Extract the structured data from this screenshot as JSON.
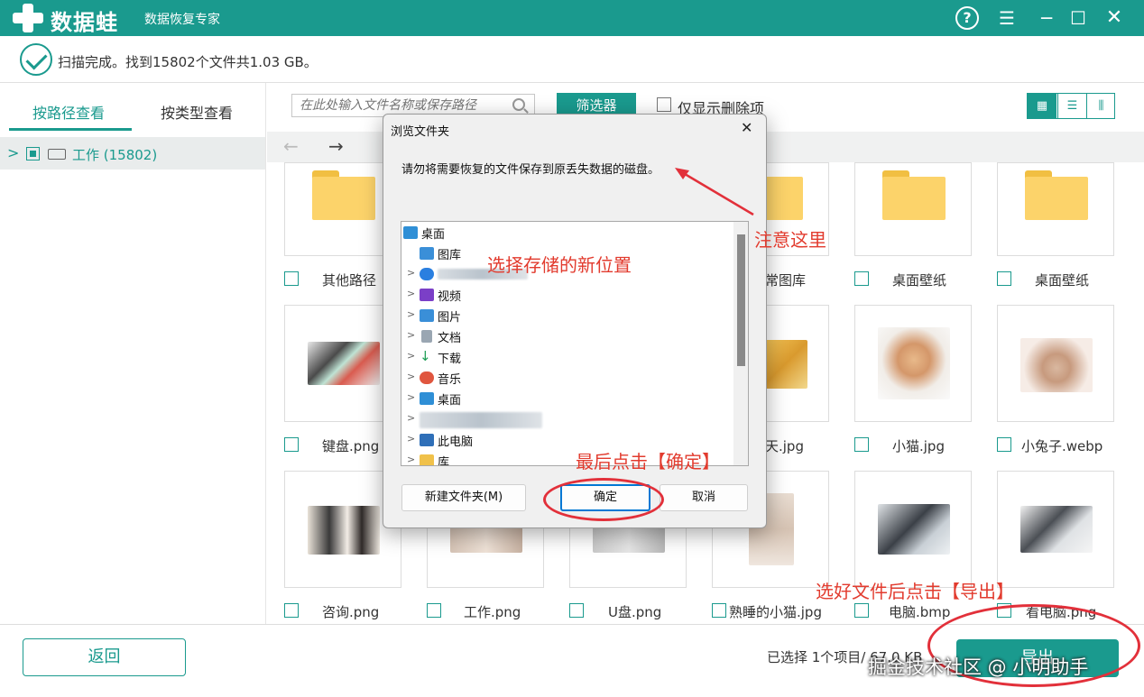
{
  "app": {
    "logo_text": "数据蛙",
    "subtitle": "数据恢复专家",
    "help": "?",
    "menu": "☰",
    "minimize": "─",
    "maximize": "☐",
    "close": "✕"
  },
  "status": {
    "text": "扫描完成。找到15802个文件共1.03 GB。"
  },
  "left": {
    "tab_path": "按路径查看",
    "tab_type": "按类型查看",
    "tree_item": "工作 (15802)"
  },
  "toolbar": {
    "search_placeholder": "在此处输入文件名称或保存路径",
    "filter": "筛选器",
    "deleted_only": "仅显示删除项",
    "view_grid": "▦",
    "view_list": "☰",
    "view_detail": "⫼"
  },
  "nav": {
    "back": "←",
    "forward": "→"
  },
  "files": {
    "row1": [
      "其他路径",
      "常图库",
      "桌面壁纸",
      "桌面壁纸"
    ],
    "row2": [
      "键盘.png",
      "天.jpg",
      "小猫.jpg",
      "小兔子.webp"
    ],
    "row3": [
      "咨询.png",
      "工作.png",
      "U盘.png",
      "熟睡的小猫.jpg",
      "电脑.bmp",
      "看电脑.png"
    ]
  },
  "dialog": {
    "title": "浏览文件夹",
    "close": "✕",
    "prompt": "请勿将需要恢复的文件保存到原丢失数据的磁盘。",
    "tree": {
      "desktop": "桌面",
      "gallery": "图库",
      "videos": "视频",
      "pictures": "图片",
      "documents": "文档",
      "downloads": "下载",
      "music": "音乐",
      "desktop2": "桌面",
      "this_pc": "此电脑",
      "library": "库"
    },
    "btn_new_folder": "新建文件夹(M)",
    "btn_ok": "确定",
    "btn_cancel": "取消"
  },
  "annotations": {
    "attention": "注意这里",
    "choose_location": "选择存储的新位置",
    "click_ok": "最后点击【确定】",
    "click_export": "选好文件后点击【导出】"
  },
  "bottom": {
    "back": "返回",
    "selected": "已选择 1个项目/ 67.0 KB",
    "export": "导出"
  },
  "watermark": "掘金技术社区 @ 小明助手",
  "colors": {
    "accent": "#1a9a8e",
    "annotation": "#e23b2e",
    "folder": "#fcd36a"
  }
}
